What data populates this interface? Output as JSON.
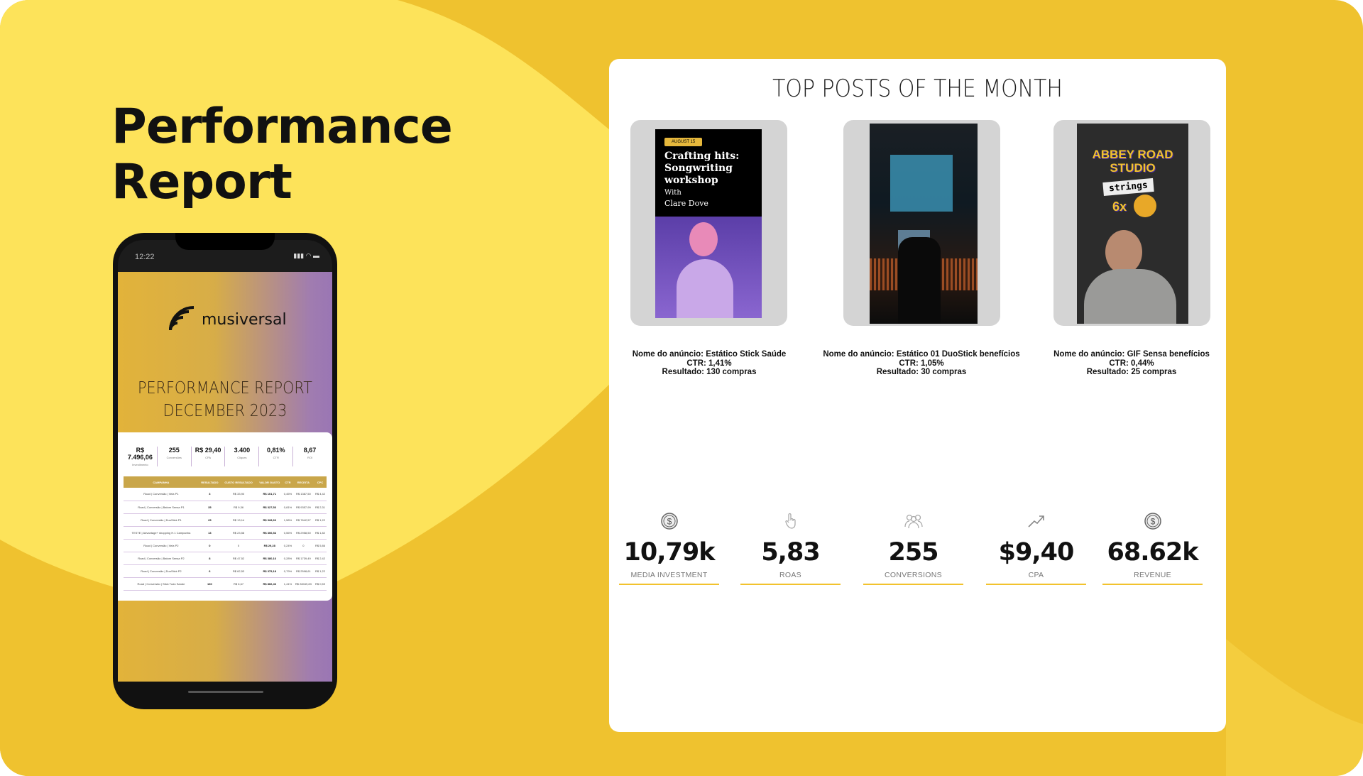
{
  "heading": {
    "line1": "Performance",
    "line2": "Report"
  },
  "phone": {
    "time": "12:22",
    "brand": "musiversal",
    "report_title_1": "PERFORMANCE REPORT",
    "report_title_2": "DECEMBER 2023",
    "summary": [
      {
        "value": "R$ 7.496,06",
        "label": "Investimento"
      },
      {
        "value": "255",
        "label": "Conversões"
      },
      {
        "value": "R$ 29,40",
        "label": "CPA"
      },
      {
        "value": "3.400",
        "label": "Cliques"
      },
      {
        "value": "0,81%",
        "label": "CTR"
      },
      {
        "value": "8,67",
        "label": "ROI"
      }
    ],
    "table": {
      "headers": [
        "CAMPANHA",
        "RESULTADO",
        "CUSTO RESULTADO",
        "VALOR GASTO",
        "CTR",
        "RECEITA",
        "CPC"
      ],
      "rows": [
        [
          "Road | Conversão | Vela P1",
          "3",
          "R$ 33,90",
          "R$ 101,71",
          "0,45%",
          "R$ 1387,50",
          "R$ 4,42"
        ],
        [
          "Road | Conversão | Batom Sensa P1",
          "35",
          "R$ 9,36",
          "R$ 327,53",
          "0,81%",
          "R$ 9357,99",
          "R$ 2,31"
        ],
        [
          "Road | Conversão | DuoStick P1",
          "25",
          "R$ 13,14",
          "R$ 328,60",
          "1,58%",
          "R$ 7642,57",
          "R$ 1,22"
        ],
        [
          "TESTE | Advantage+ shopping H.1 Campanha",
          "13",
          "R$ 23,58",
          "R$ 306,54",
          "0,56%",
          "R$ 2958,50",
          "R$ 1,82"
        ],
        [
          "Road | Conversão | Vela P2",
          "0",
          "0",
          "R$ 29,28",
          "0,24%",
          "0",
          "R$ 5,86"
        ],
        [
          "Road | Conversão | Batom Sensa P2",
          "8",
          "R$ 47,52",
          "R$ 380,16",
          "0,28%",
          "R$ 1739,49",
          "R$ 2,42"
        ],
        [
          "Road | Conversão | DuoStick P2",
          "6",
          "R$ 62,53",
          "R$ 375,18",
          "0,79%",
          "R$ 2598,61",
          "R$ 1,22"
        ],
        [
          "Road | Conversão | Stick Tudo Saúde",
          "130",
          "R$ 6,67",
          "R$ 866,46",
          "1,41%",
          "R$ 28049,83",
          "R$ 0,59"
        ]
      ]
    }
  },
  "posts": {
    "title": "TOP POSTS OF THE MONTH",
    "items": [
      {
        "name": "Nome do anúncio: Estático Stick Saúde",
        "ctr": "CTR: 1,41%",
        "result": "Resultado: 130 compras",
        "badge": "AUGUST 15",
        "headline": "Crafting hits: Songwriting workshop",
        "with": "With",
        "artist": "Clare Dove"
      },
      {
        "name": "Nome do anúncio: Estático 01 DuoStick benefícios",
        "ctr": "CTR: 1,05%",
        "result": "Resultado: 30 compras"
      },
      {
        "name": "Nome do anúncio: GIF Sensa benefícios",
        "ctr": "CTR: 0,44%",
        "result": "Resultado: 25 compras",
        "headline": "ABBEY ROAD STUDIO",
        "tag": "strings",
        "mult": "6x"
      }
    ]
  },
  "kpis": [
    {
      "icon": "dollar-coin-icon",
      "value": "10,79k",
      "label": "MEDIA INVESTMENT"
    },
    {
      "icon": "pointer-hand-icon",
      "value": "5,83",
      "label": "ROAS"
    },
    {
      "icon": "people-group-icon",
      "value": "255",
      "label": "CONVERSIONS"
    },
    {
      "icon": "trend-up-icon",
      "value": "$9,40",
      "label": "CPA"
    },
    {
      "icon": "dollar-coin-icon",
      "value": "68.62k",
      "label": "REVENUE"
    }
  ],
  "colors": {
    "background": "#efc22f",
    "wave": "#fde35a",
    "accent": "#f2c22d"
  }
}
